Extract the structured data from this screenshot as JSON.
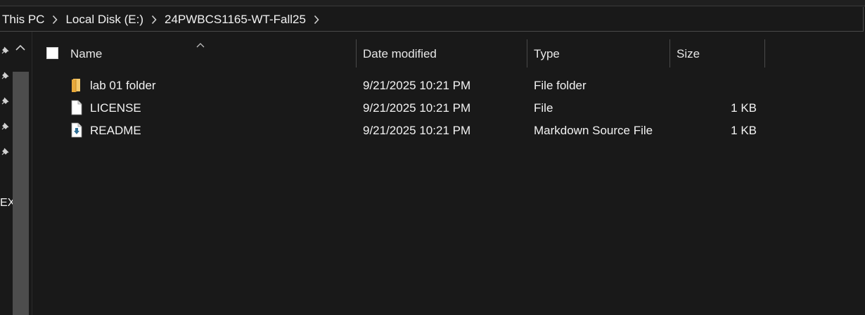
{
  "breadcrumb": {
    "items": [
      "This PC",
      "Local Disk (E:)",
      "24PWBCS1165-WT-Fall25"
    ]
  },
  "sidebar": {
    "partial_label": "EX"
  },
  "columns": {
    "name": "Name",
    "date_modified": "Date modified",
    "type": "Type",
    "size": "Size"
  },
  "files": [
    {
      "name": "lab 01 folder",
      "date": "9/21/2025 10:21 PM",
      "type": "File folder",
      "size": "",
      "icon": "folder-icon"
    },
    {
      "name": "LICENSE",
      "date": "9/21/2025 10:21 PM",
      "type": "File",
      "size": "1 KB",
      "icon": "file-icon"
    },
    {
      "name": "README",
      "date": "9/21/2025 10:21 PM",
      "type": "Markdown Source File",
      "size": "1 KB",
      "icon": "markdown-file-icon"
    }
  ],
  "colors": {
    "background": "#191919",
    "folder": "#f2c255",
    "markdown_arrow": "#2e6f96"
  }
}
